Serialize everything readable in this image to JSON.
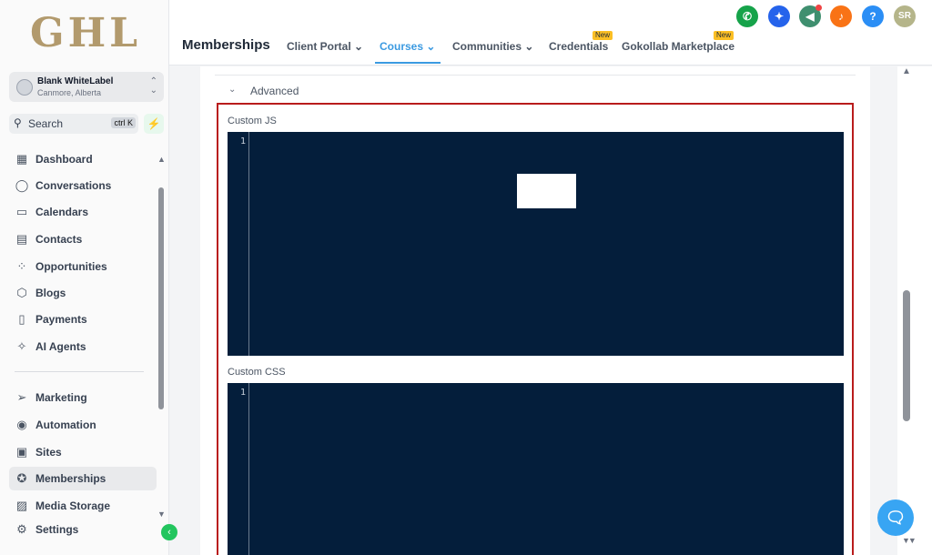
{
  "logo": "GHL",
  "account": {
    "name": "Blank WhiteLabel",
    "location": "Canmore, Alberta"
  },
  "search": {
    "placeholder": "Search",
    "shortcut": "ctrl K"
  },
  "nav": [
    {
      "label": "Dashboard",
      "icon": "grid-icon"
    },
    {
      "label": "Conversations",
      "icon": "chat-icon"
    },
    {
      "label": "Calendars",
      "icon": "calendar-icon"
    },
    {
      "label": "Contacts",
      "icon": "contacts-icon"
    },
    {
      "label": "Opportunities",
      "icon": "opportunities-icon"
    },
    {
      "label": "Blogs",
      "icon": "cube-icon"
    },
    {
      "label": "Payments",
      "icon": "receipt-icon"
    },
    {
      "label": "AI Agents",
      "icon": "sparkle-icon"
    },
    {
      "label": "Marketing",
      "icon": "send-icon"
    },
    {
      "label": "Automation",
      "icon": "automation-icon"
    },
    {
      "label": "Sites",
      "icon": "sites-icon"
    },
    {
      "label": "Memberships",
      "icon": "award-icon"
    },
    {
      "label": "Media Storage",
      "icon": "image-icon"
    },
    {
      "label": "Settings",
      "icon": "gear-icon"
    }
  ],
  "header": {
    "title": "Memberships",
    "tabs": [
      "Client Portal",
      "Courses",
      "Communities",
      "Credentials",
      "Gokollab Marketplace"
    ],
    "active_tab": "Courses",
    "new_badge": "New",
    "avatar_initials": "SR",
    "help_glyph": "?"
  },
  "main": {
    "section": "Advanced",
    "custom_js_label": "Custom JS",
    "custom_css_label": "Custom CSS",
    "line_number": "1"
  },
  "colors": {
    "accent": "#3b9ae1",
    "editor_bg": "#041e3b",
    "highlight_border": "#b91c1c",
    "logo": "#b29a6d"
  }
}
